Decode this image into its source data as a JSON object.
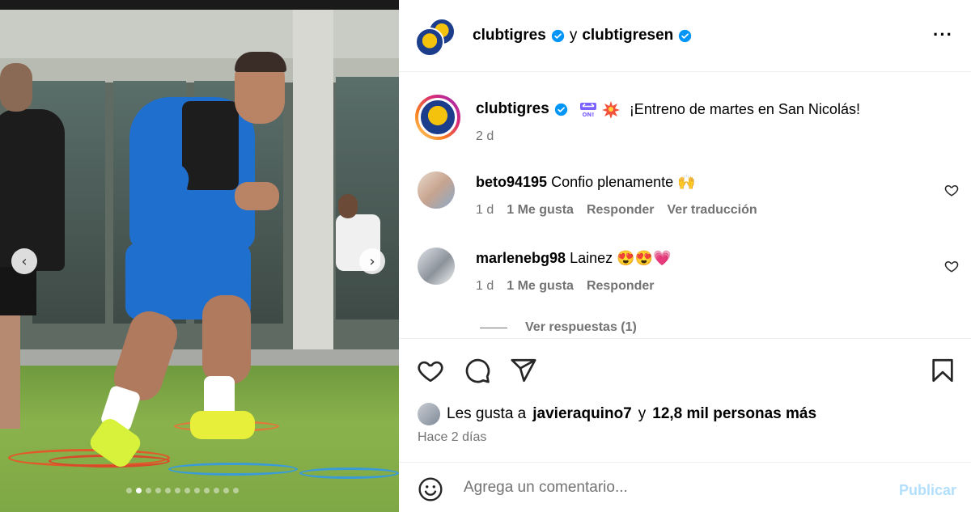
{
  "photo": {
    "prev_arrow": "‹",
    "next_arrow": "›",
    "dots_count": 12,
    "active_dot": 1
  },
  "header": {
    "user1": "clubtigres",
    "connector": "y",
    "user2": "clubtigresen",
    "more": "···"
  },
  "caption": {
    "username": "clubtigres",
    "text": "¡Entreno de martes en San Nicolás!",
    "age": "2 d"
  },
  "comments": [
    {
      "username": "beto94195",
      "text": "Confio plenamente 🙌",
      "age": "1 d",
      "likes": "1 Me gusta",
      "reply": "Responder",
      "translate": "Ver traducción"
    },
    {
      "username": "marlenebg98",
      "text": "Lainez 😍😍💗",
      "age": "1 d",
      "likes": "1 Me gusta",
      "reply": "Responder",
      "view_replies": "Ver respuestas (1)"
    }
  ],
  "likes": {
    "prefix": "Les gusta a",
    "user": "javieraquino7",
    "connector": "y",
    "others": "12,8 mil personas más"
  },
  "timestamp": "Hace 2 días",
  "add_comment": {
    "placeholder": "Agrega un comentario...",
    "publish_label": "Publicar"
  },
  "colors": {
    "verified": "#0095f6",
    "publish_disabled": "#b2dffc",
    "secondary_text": "#737373"
  }
}
